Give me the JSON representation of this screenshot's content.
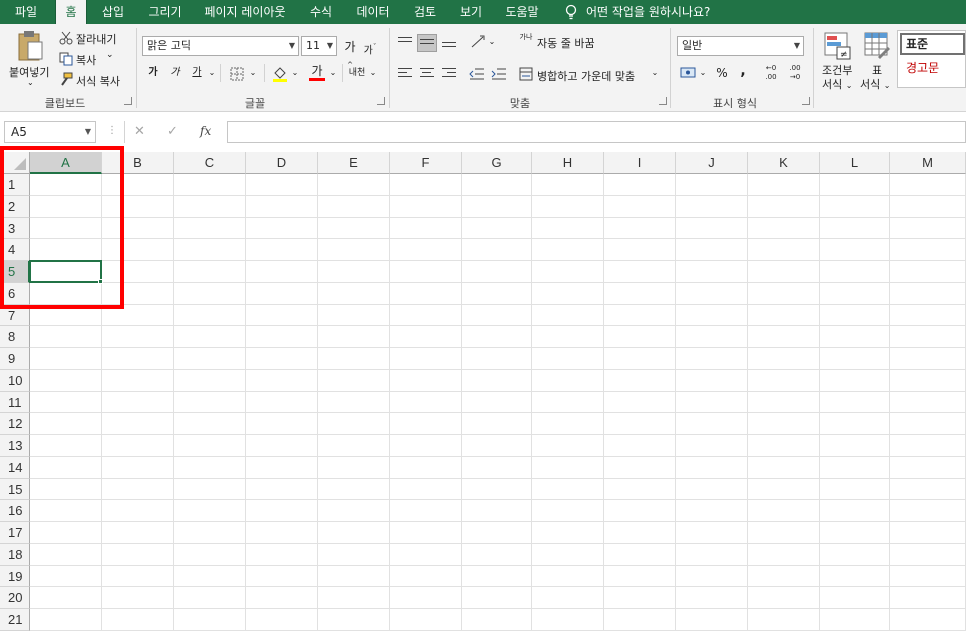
{
  "tabs": [
    {
      "label": "파일",
      "active": false
    },
    {
      "label": "홈",
      "active": true
    },
    {
      "label": "삽입",
      "active": false
    },
    {
      "label": "그리기",
      "active": false
    },
    {
      "label": "페이지 레이아웃",
      "active": false
    },
    {
      "label": "수식",
      "active": false
    },
    {
      "label": "데이터",
      "active": false
    },
    {
      "label": "검토",
      "active": false
    },
    {
      "label": "보기",
      "active": false
    },
    {
      "label": "도움말",
      "active": false
    }
  ],
  "tell_me": "어떤 작업을 원하시나요?",
  "clipboard": {
    "paste": "붙여넣기",
    "cut": "잘라내기",
    "copy": "복사",
    "format_painter": "서식 복사",
    "label": "클립보드"
  },
  "font": {
    "name": "맑은 고딕",
    "size": "11",
    "grow": "가",
    "shrink": "가",
    "bold": "가",
    "italic": "가",
    "underline": "가",
    "font_color": "가",
    "phonetic": "내천",
    "label": "글꼴"
  },
  "alignment": {
    "wrap": "자동 줄 바꿈",
    "merge": "병합하고 가운데 맞춤",
    "wrap_icon_text": "가나",
    "label": "맞춤"
  },
  "number": {
    "format": "일반",
    "percent": "%",
    "comma": ",",
    "increase_decimal": "←0 .00",
    "decrease_decimal": ".00 →0",
    "label": "표시 형식"
  },
  "styles": {
    "conditional_line1": "조건부",
    "conditional_line2": "서식",
    "table_line1": "표",
    "table_line2": "서식",
    "normal": "표준",
    "bad": "경고문"
  },
  "formula_bar": {
    "name_box": "A5",
    "cancel": "✕",
    "enter": "✓",
    "fx": "fx",
    "value": ""
  },
  "columns": [
    "A",
    "B",
    "C",
    "D",
    "E",
    "F",
    "G",
    "H",
    "I",
    "J",
    "K",
    "L",
    "M"
  ],
  "rows": [
    "1",
    "2",
    "3",
    "4",
    "5",
    "6",
    "7",
    "8",
    "9",
    "10",
    "11",
    "12",
    "13",
    "14",
    "15",
    "16",
    "17",
    "18",
    "19",
    "20",
    "21"
  ],
  "active_cell": {
    "col": "A",
    "row": "5"
  },
  "colors": {
    "accent": "#217346",
    "highlight": "#ff0000",
    "font_color_bar": "#ff0000",
    "fill_color_bar": "#ffff00",
    "bad_text": "#c00000"
  }
}
